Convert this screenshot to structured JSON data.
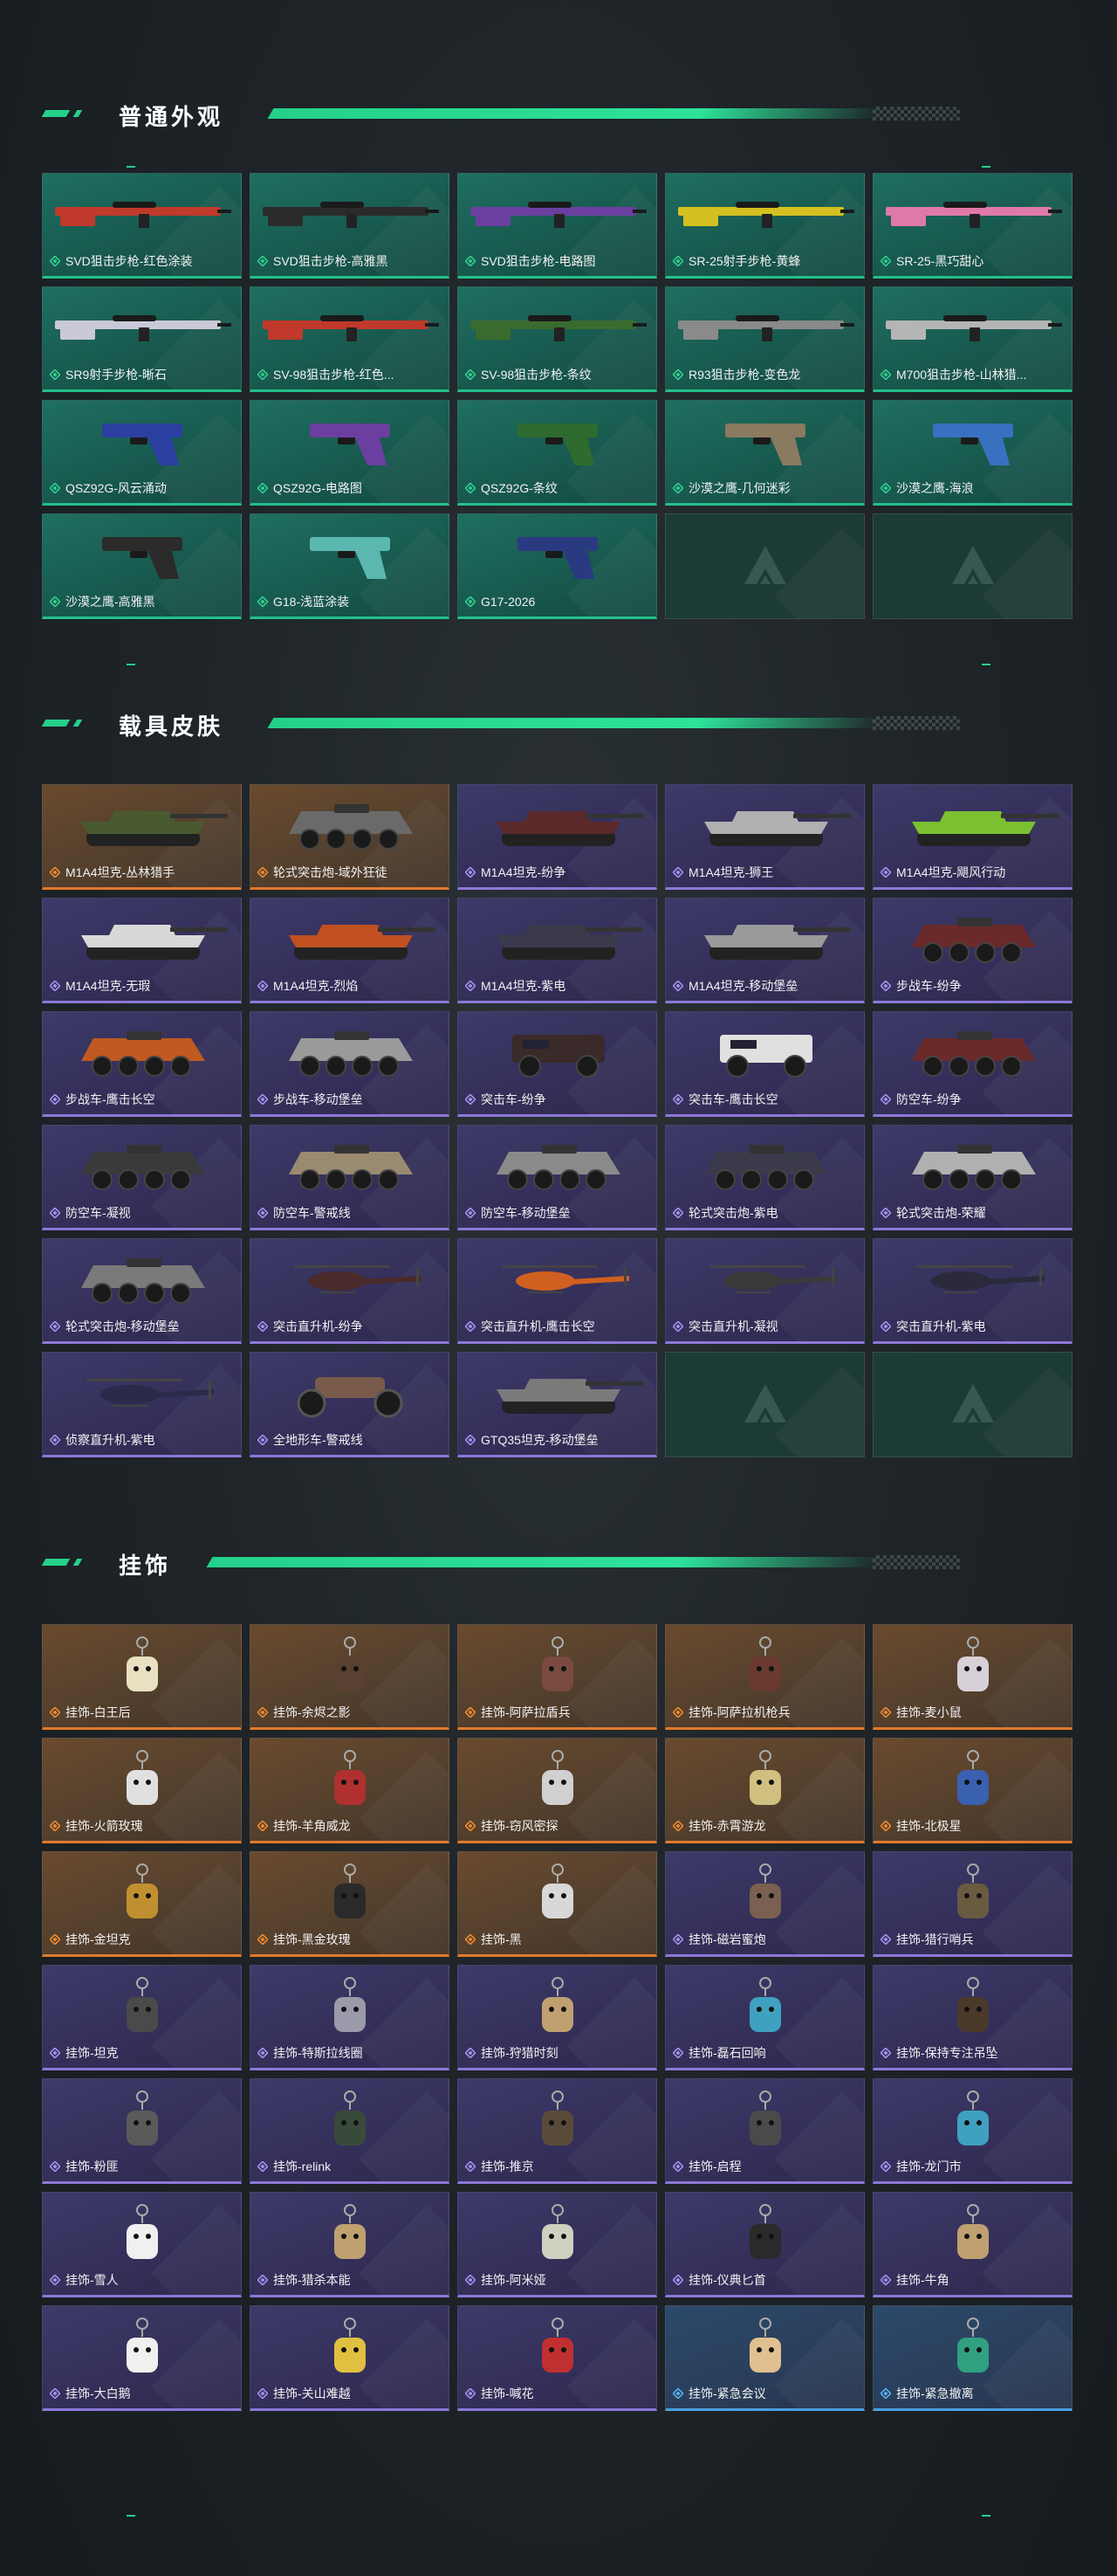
{
  "colors": {
    "accent": "#25d08a",
    "green_card": "#1f6f60",
    "purple_card": "#3e3a69",
    "orange_card": "#6a4a2e",
    "blue_card": "#2c4a6a"
  },
  "sections": [
    {
      "title": "普通外观",
      "items": [
        {
          "name": "SVD狙击步枪-红色涂装",
          "rarity": "green",
          "kind": "rifle",
          "color": "#c0392b"
        },
        {
          "name": "SVD狙击步枪-高雅黑",
          "rarity": "green",
          "kind": "rifle",
          "color": "#2b2b2b"
        },
        {
          "name": "SVD狙击步枪-电路图",
          "rarity": "green",
          "kind": "rifle",
          "color": "#6b3fa0"
        },
        {
          "name": "SR-25射手步枪-黄蜂",
          "rarity": "green",
          "kind": "rifle",
          "color": "#d4c020"
        },
        {
          "name": "SR-25-黑巧甜心",
          "rarity": "green",
          "kind": "rifle",
          "color": "#e079a8"
        },
        {
          "name": "SR9射手步枪-晰石",
          "rarity": "green",
          "kind": "rifle",
          "color": "#c9c9d8"
        },
        {
          "name": "SV-98狙击步枪-红色...",
          "rarity": "green",
          "kind": "rifle",
          "color": "#c0392b"
        },
        {
          "name": "SV-98狙击步枪-条纹",
          "rarity": "green",
          "kind": "rifle",
          "color": "#3a6b2e"
        },
        {
          "name": "R93狙击步枪-变色龙",
          "rarity": "green",
          "kind": "rifle",
          "color": "#8a8a8a"
        },
        {
          "name": "M700狙击步枪-山林猎...",
          "rarity": "green",
          "kind": "rifle",
          "color": "#b5b5b5"
        },
        {
          "name": "QSZ92G-风云涌动",
          "rarity": "green",
          "kind": "pistol",
          "color": "#2a3fa0"
        },
        {
          "name": "QSZ92G-电路图",
          "rarity": "green",
          "kind": "pistol",
          "color": "#6b3fa0"
        },
        {
          "name": "QSZ92G-条纹",
          "rarity": "green",
          "kind": "pistol",
          "color": "#2f6b2e"
        },
        {
          "name": "沙漠之鹰-几何迷彩",
          "rarity": "green",
          "kind": "pistol",
          "color": "#8a7a60"
        },
        {
          "name": "沙漠之鹰-海浪",
          "rarity": "green",
          "kind": "pistol",
          "color": "#3a70c0"
        },
        {
          "name": "沙漠之鹰-高雅黑",
          "rarity": "green",
          "kind": "pistol",
          "color": "#2b2b2b"
        },
        {
          "name": "G18-浅蓝涂装",
          "rarity": "green",
          "kind": "pistol",
          "color": "#5ab8b0"
        },
        {
          "name": "G17-2026",
          "rarity": "green",
          "kind": "pistol",
          "color": "#2a3a80"
        },
        {
          "name": "",
          "rarity": "empty"
        },
        {
          "name": "",
          "rarity": "empty"
        }
      ]
    },
    {
      "title": "载具皮肤",
      "items": [
        {
          "name": "M1A4坦克-丛林猎手",
          "rarity": "orange",
          "kind": "tank",
          "color": "#4a5a30"
        },
        {
          "name": "轮式突击炮-域外狂徒",
          "rarity": "orange",
          "kind": "apc",
          "color": "#6a6a6a"
        },
        {
          "name": "M1A4坦克-纷争",
          "rarity": "purple",
          "kind": "tank",
          "color": "#5a2a2a"
        },
        {
          "name": "M1A4坦克-狮王",
          "rarity": "purple",
          "kind": "tank",
          "color": "#b0b0b0"
        },
        {
          "name": "M1A4坦克-飓风行动",
          "rarity": "purple",
          "kind": "tank",
          "color": "#7ac030"
        },
        {
          "name": "M1A4坦克-无瑕",
          "rarity": "purple",
          "kind": "tank",
          "color": "#d8d8d8"
        },
        {
          "name": "M1A4坦克-烈焰",
          "rarity": "purple",
          "kind": "tank",
          "color": "#c05020"
        },
        {
          "name": "M1A4坦克-紫电",
          "rarity": "purple",
          "kind": "tank",
          "color": "#3a3a4a"
        },
        {
          "name": "M1A4坦克-移动堡垒",
          "rarity": "purple",
          "kind": "tank",
          "color": "#9a9a9a"
        },
        {
          "name": "步战车-纷争",
          "rarity": "purple",
          "kind": "apc",
          "color": "#6a2a2a"
        },
        {
          "name": "步战车-鹰击长空",
          "rarity": "purple",
          "kind": "apc",
          "color": "#c05a20"
        },
        {
          "name": "步战车-移动堡垒",
          "rarity": "purple",
          "kind": "apc",
          "color": "#9a9a9a"
        },
        {
          "name": "突击车-纷争",
          "rarity": "purple",
          "kind": "truck",
          "color": "#3a2a2a"
        },
        {
          "name": "突击车-鹰击长空",
          "rarity": "purple",
          "kind": "truck",
          "color": "#e0e0e0"
        },
        {
          "name": "防空车-纷争",
          "rarity": "purple",
          "kind": "apc",
          "color": "#6a2a2a"
        },
        {
          "name": "防空车-凝视",
          "rarity": "purple",
          "kind": "apc",
          "color": "#3a3a3a"
        },
        {
          "name": "防空车-警戒线",
          "rarity": "purple",
          "kind": "apc",
          "color": "#9a8a70"
        },
        {
          "name": "防空车-移动堡垒",
          "rarity": "purple",
          "kind": "apc",
          "color": "#8a8a8a"
        },
        {
          "name": "轮式突击炮-紫电",
          "rarity": "purple",
          "kind": "apc",
          "color": "#3a3a4a"
        },
        {
          "name": "轮式突击炮-荣耀",
          "rarity": "purple",
          "kind": "apc",
          "color": "#b0b0b0"
        },
        {
          "name": "轮式突击炮-移动堡垒",
          "rarity": "purple",
          "kind": "apc",
          "color": "#7a7a7a"
        },
        {
          "name": "突击直升机-纷争",
          "rarity": "purple",
          "kind": "heli",
          "color": "#4a2a2a"
        },
        {
          "name": "突击直升机-鹰击长空",
          "rarity": "purple",
          "kind": "heli",
          "color": "#d06020"
        },
        {
          "name": "突击直升机-凝视",
          "rarity": "purple",
          "kind": "heli",
          "color": "#3a3a3a"
        },
        {
          "name": "突击直升机-紫电",
          "rarity": "purple",
          "kind": "heli",
          "color": "#2a2a3a"
        },
        {
          "name": "侦察直升机-紫电",
          "rarity": "purple",
          "kind": "heli",
          "color": "#2a2a4a"
        },
        {
          "name": "全地形车-警戒线",
          "rarity": "purple",
          "kind": "atv",
          "color": "#7a5a4a"
        },
        {
          "name": "GTQ35坦克-移动堡垒",
          "rarity": "purple",
          "kind": "tank",
          "color": "#7a7a7a"
        },
        {
          "name": "",
          "rarity": "empty"
        },
        {
          "name": "",
          "rarity": "empty"
        }
      ]
    },
    {
      "title": "挂饰",
      "items": [
        {
          "name": "挂饰-白王后",
          "rarity": "orange",
          "kind": "charm",
          "color": "#e8e0c0"
        },
        {
          "name": "挂饰-余烬之影",
          "rarity": "orange",
          "kind": "charm",
          "color": "#5a4030"
        },
        {
          "name": "挂饰-阿萨拉盾兵",
          "rarity": "orange",
          "kind": "charm",
          "color": "#7a4a40"
        },
        {
          "name": "挂饰-阿萨拉机枪兵",
          "rarity": "orange",
          "kind": "charm",
          "color": "#6a3a30"
        },
        {
          "name": "挂饰-麦小鼠",
          "rarity": "orange",
          "kind": "charm",
          "color": "#d8d0d8"
        },
        {
          "name": "挂饰-火箭玫瑰",
          "rarity": "orange",
          "kind": "charm",
          "color": "#e0e0e0"
        },
        {
          "name": "挂饰-羊角威龙",
          "rarity": "orange",
          "kind": "charm",
          "color": "#b03030"
        },
        {
          "name": "挂饰-窃风密探",
          "rarity": "orange",
          "kind": "charm",
          "color": "#d0d0d0"
        },
        {
          "name": "挂饰-赤霄游龙",
          "rarity": "orange",
          "kind": "charm",
          "color": "#d0c080"
        },
        {
          "name": "挂饰-北极星",
          "rarity": "orange",
          "kind": "charm",
          "color": "#3a60b0"
        },
        {
          "name": "挂饰-金坦克",
          "rarity": "orange",
          "kind": "charm",
          "color": "#c09030"
        },
        {
          "name": "挂饰-黑金玫瑰",
          "rarity": "orange",
          "kind": "charm",
          "color": "#2a2a2a"
        },
        {
          "name": "挂饰-黑",
          "rarity": "orange",
          "kind": "charm",
          "color": "#d8d8d8"
        },
        {
          "name": "挂饰-磁岩蜜炮",
          "rarity": "purple",
          "kind": "charm",
          "color": "#7a6050"
        },
        {
          "name": "挂饰-猎行哨兵",
          "rarity": "purple",
          "kind": "charm",
          "color": "#6a5a40"
        },
        {
          "name": "挂饰-坦克",
          "rarity": "purple",
          "kind": "charm",
          "color": "#4a4a4a"
        },
        {
          "name": "挂饰-特斯拉线圈",
          "rarity": "purple",
          "kind": "charm",
          "color": "#9a9aaa"
        },
        {
          "name": "挂饰-狩猎时刻",
          "rarity": "purple",
          "kind": "charm",
          "color": "#c0a070"
        },
        {
          "name": "挂饰-磊石回响",
          "rarity": "purple",
          "kind": "charm",
          "color": "#40a0c0"
        },
        {
          "name": "挂饰-保持专注吊坠",
          "rarity": "purple",
          "kind": "charm",
          "color": "#4a3a2a"
        },
        {
          "name": "挂饰-粉匪",
          "rarity": "purple",
          "kind": "charm",
          "color": "#5a5a5a"
        },
        {
          "name": "挂饰-relink",
          "rarity": "purple",
          "kind": "charm",
          "color": "#3a4a3a"
        },
        {
          "name": "挂饰-推京",
          "rarity": "purple",
          "kind": "charm",
          "color": "#5a4a3a"
        },
        {
          "name": "挂饰-启程",
          "rarity": "purple",
          "kind": "charm",
          "color": "#4a4a4a"
        },
        {
          "name": "挂饰-龙门市",
          "rarity": "purple",
          "kind": "charm",
          "color": "#40a0c0"
        },
        {
          "name": "挂饰-雪人",
          "rarity": "purple",
          "kind": "charm",
          "color": "#f0f0f0"
        },
        {
          "name": "挂饰-猎杀本能",
          "rarity": "purple",
          "kind": "charm",
          "color": "#c0a070"
        },
        {
          "name": "挂饰-阿米娅",
          "rarity": "purple",
          "kind": "charm",
          "color": "#d0d0c0"
        },
        {
          "name": "挂饰-仪典匕首",
          "rarity": "purple",
          "kind": "charm",
          "color": "#2a2a2a"
        },
        {
          "name": "挂饰-牛角",
          "rarity": "purple",
          "kind": "charm",
          "color": "#c0a070"
        },
        {
          "name": "挂饰-大白鹅",
          "rarity": "purple",
          "kind": "charm",
          "color": "#f0f0f0"
        },
        {
          "name": "挂饰-关山难越",
          "rarity": "purple",
          "kind": "charm",
          "color": "#e0c040"
        },
        {
          "name": "挂饰-喊花",
          "rarity": "purple",
          "kind": "charm",
          "color": "#c03030"
        },
        {
          "name": "挂饰-紧急会议",
          "rarity": "blue",
          "kind": "charm",
          "color": "#e0c090"
        },
        {
          "name": "挂饰-紧急撤离",
          "rarity": "blue",
          "kind": "charm",
          "color": "#30a080"
        }
      ]
    }
  ]
}
